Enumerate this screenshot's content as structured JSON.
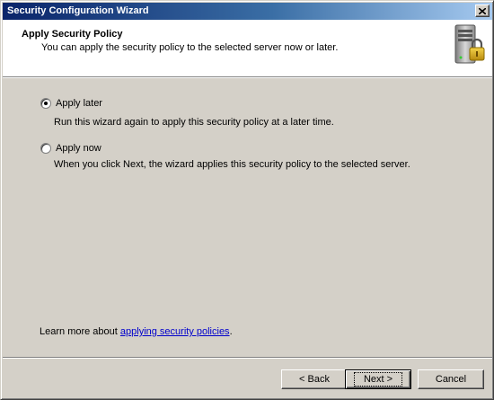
{
  "window": {
    "title": "Security Configuration Wizard"
  },
  "header": {
    "title": "Apply Security Policy",
    "subtitle": "You can apply the security policy to the selected server now or later.",
    "icon": "server-lock-icon"
  },
  "options": [
    {
      "label": "Apply later",
      "description": "Run this wizard again to apply this security policy at a later time.",
      "selected": true
    },
    {
      "label": "Apply now",
      "description": "When you click Next, the wizard applies this security policy to the selected server.",
      "selected": false
    }
  ],
  "learn_more": {
    "prefix": "Learn more about ",
    "link": "applying security policies",
    "suffix": "."
  },
  "buttons": {
    "back": "< Back",
    "next": "Next >",
    "cancel": "Cancel"
  },
  "colors": {
    "dialog_bg": "#d4d0c8",
    "titlebar_start": "#0a246a",
    "titlebar_end": "#a6caf0",
    "link": "#0000cc"
  }
}
